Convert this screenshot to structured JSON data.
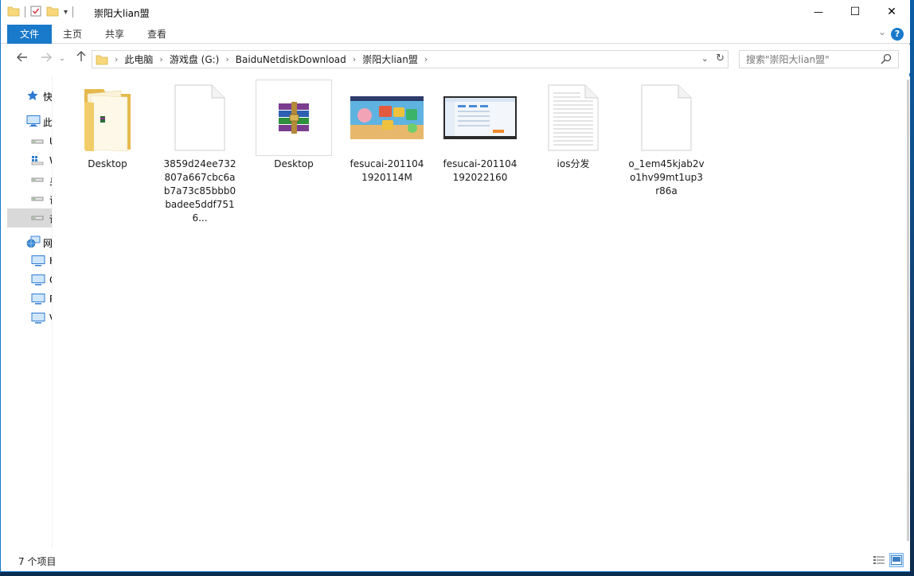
{
  "window": {
    "title": "崇阳大lian盟",
    "controls": {
      "minimize": "—",
      "maximize": "☐",
      "close": "✕"
    }
  },
  "ribbon": {
    "tabs": [
      {
        "label": "文件",
        "active": true
      },
      {
        "label": "主页"
      },
      {
        "label": "共享"
      },
      {
        "label": "查看"
      }
    ],
    "help": "?"
  },
  "address": {
    "crumbs": [
      "此电脑",
      "游戏盘 (G:)",
      "BaiduNetdiskDownload",
      "崇阳大lian盟"
    ]
  },
  "search": {
    "placeholder": "搜索\"崇阳大lian盟\""
  },
  "navpane": {
    "items": [
      {
        "label": "快",
        "icon": "star-icon"
      },
      {
        "label": "此",
        "icon": "pc-icon"
      },
      {
        "label": "U",
        "icon": "drive-icon"
      },
      {
        "label": "W",
        "icon": "windows-drive-icon"
      },
      {
        "label": "身",
        "icon": "drive-icon"
      },
      {
        "label": "语",
        "icon": "drive-icon"
      },
      {
        "label": "说",
        "icon": "drive-icon"
      },
      {
        "label": "网",
        "icon": "network-icon"
      },
      {
        "label": "H",
        "icon": "computer-icon"
      },
      {
        "label": "C",
        "icon": "computer-icon"
      },
      {
        "label": "P",
        "icon": "computer-icon"
      },
      {
        "label": "V",
        "icon": "computer-icon"
      }
    ]
  },
  "files": [
    {
      "name": "Desktop",
      "type": "folder",
      "icon": "folder-icon"
    },
    {
      "name": "3859d24ee732807a667cbc6ab7a73c85bbb0badee5ddf7516...",
      "type": "file",
      "icon": "blank-file-icon"
    },
    {
      "name": "Desktop",
      "type": "archive",
      "icon": "winrar-archive-icon"
    },
    {
      "name": "fesucai-2011041920114M",
      "type": "image",
      "icon": "game-screenshot-thumbnail"
    },
    {
      "name": "fesucai-201104192022160",
      "type": "image",
      "icon": "app-screenshot-thumbnail"
    },
    {
      "name": "ios分发",
      "type": "text",
      "icon": "text-file-icon"
    },
    {
      "name": "o_1em45kjab2vo1hv99mt1up3r86a",
      "type": "file",
      "icon": "blank-file-icon"
    }
  ],
  "status": {
    "count": "7 个项目"
  },
  "colors": {
    "accent": "#1979ca",
    "folder": "#f7d77a",
    "selection": "#cce8ff"
  }
}
